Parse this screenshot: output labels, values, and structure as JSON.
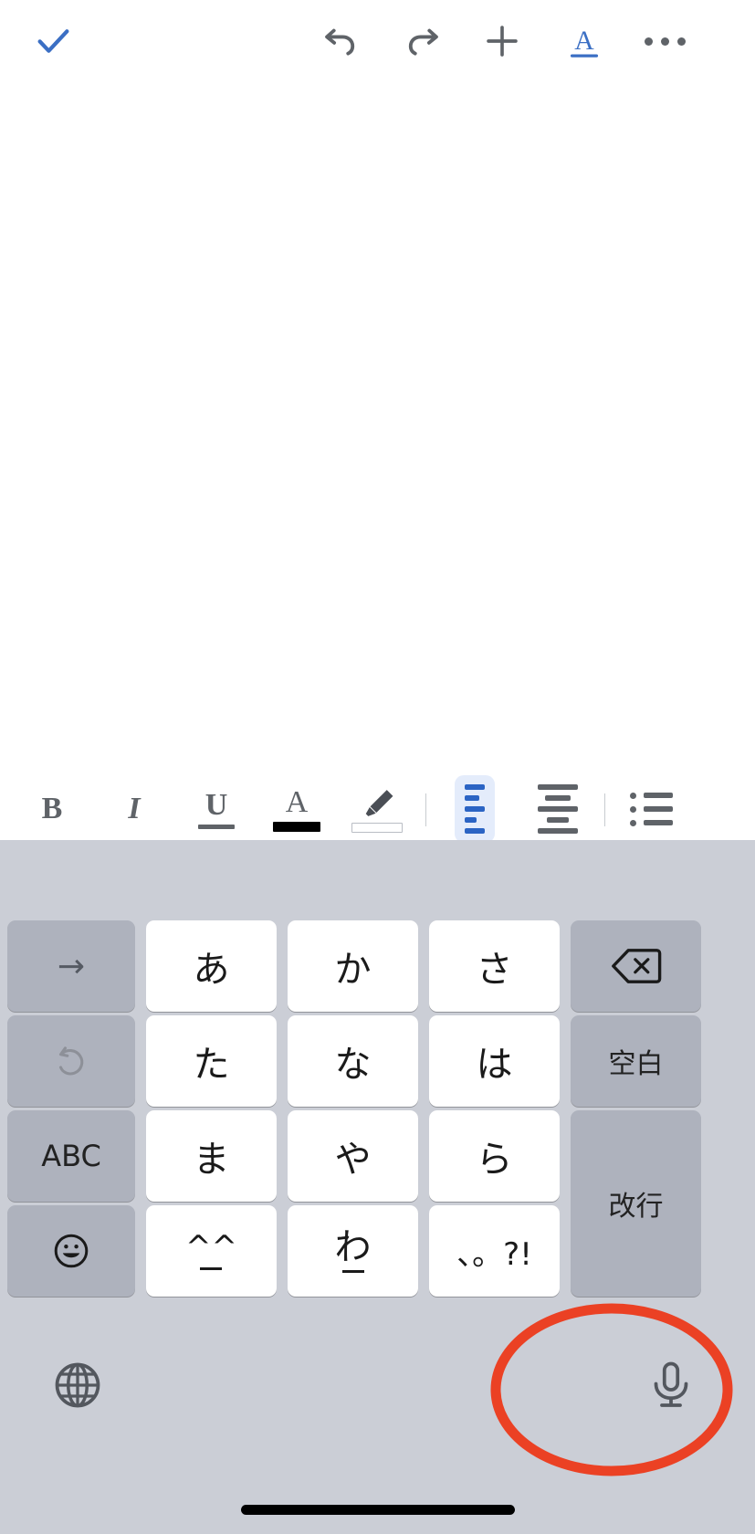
{
  "app": {
    "screen_name": "note-editor-with-japanese-kana-keyboard",
    "background_color": "#ffffff",
    "keyboard_background_color": "#cbced6"
  },
  "top_toolbar": {
    "items": [
      {
        "name": "done-button",
        "icon": "checkmark-icon",
        "color": "#3b6fc4",
        "interactable": true
      },
      {
        "name": "undo-button",
        "icon": "undo-arrow-icon",
        "color": "#5f6368",
        "interactable": true
      },
      {
        "name": "redo-button",
        "icon": "redo-arrow-icon",
        "color": "#5f6368",
        "interactable": true
      },
      {
        "name": "insert-button",
        "icon": "plus-icon",
        "color": "#5f6368",
        "interactable": true
      },
      {
        "name": "text-format-button",
        "icon": "underlined-a-icon",
        "color": "#3b6fc4",
        "label": "A",
        "interactable": true
      },
      {
        "name": "more-options-button",
        "icon": "ellipsis-icon",
        "color": "#5f6368",
        "interactable": true
      }
    ]
  },
  "format_bar": {
    "bold_label": "B",
    "italic_label": "I",
    "underline_label": "U",
    "text_color_label": "A",
    "text_color_swatch": "#000000",
    "highlight_swatch": "#ffffff",
    "items": [
      {
        "name": "bold-button",
        "icon": "bold-icon",
        "active": false
      },
      {
        "name": "italic-button",
        "icon": "italic-icon",
        "active": false
      },
      {
        "name": "underline-button",
        "icon": "underline-icon",
        "active": false
      },
      {
        "name": "text-color-button",
        "icon": "text-color-a-icon",
        "active": false
      },
      {
        "name": "highlight-button",
        "icon": "highlighter-pen-icon",
        "active": false
      },
      {
        "name": "align-left-button",
        "icon": "align-left-icon",
        "active": true
      },
      {
        "name": "align-center-button",
        "icon": "align-center-icon",
        "active": false
      },
      {
        "name": "bulleted-list-button",
        "icon": "bulleted-list-icon",
        "active": false
      }
    ],
    "active_color": "#2b64c4",
    "active_background": "#e4ecfb",
    "inactive_color": "#5f6368"
  },
  "keyboard": {
    "layout": "japanese-kana-12key",
    "rows": [
      [
        {
          "name": "key-next-candidate",
          "label": "→",
          "type": "gray",
          "role": "function"
        },
        {
          "name": "key-a-row",
          "label": "あ",
          "type": "white",
          "role": "kana"
        },
        {
          "name": "key-ka-row",
          "label": "か",
          "type": "white",
          "role": "kana"
        },
        {
          "name": "key-sa-row",
          "label": "さ",
          "type": "white",
          "role": "kana"
        },
        {
          "name": "key-backspace",
          "label": "⌫",
          "type": "gray",
          "role": "function"
        }
      ],
      [
        {
          "name": "key-undo",
          "label": "↺",
          "type": "gray",
          "role": "function",
          "disabled": true
        },
        {
          "name": "key-ta-row",
          "label": "た",
          "type": "white",
          "role": "kana"
        },
        {
          "name": "key-na-row",
          "label": "な",
          "type": "white",
          "role": "kana"
        },
        {
          "name": "key-ha-row",
          "label": "は",
          "type": "white",
          "role": "kana"
        },
        {
          "name": "key-space",
          "label": "空白",
          "type": "gray",
          "role": "function"
        }
      ],
      [
        {
          "name": "key-abc-mode",
          "label": "ABC",
          "type": "gray",
          "role": "function"
        },
        {
          "name": "key-ma-row",
          "label": "ま",
          "type": "white",
          "role": "kana"
        },
        {
          "name": "key-ya-row",
          "label": "や",
          "type": "white",
          "role": "kana"
        },
        {
          "name": "key-ra-row",
          "label": "ら",
          "type": "white",
          "role": "kana"
        },
        {
          "name": "key-return",
          "label": "改行",
          "type": "gray",
          "role": "function",
          "tall": true
        }
      ],
      [
        {
          "name": "key-emoji",
          "label": "☺",
          "type": "gray",
          "role": "function"
        },
        {
          "name": "key-kaomoji",
          "label": "^^",
          "type": "white",
          "role": "kana",
          "underscore": true
        },
        {
          "name": "key-wa-row",
          "label": "わ",
          "type": "white",
          "role": "kana",
          "underscore": true
        },
        {
          "name": "key-punctuation",
          "label": "、。?!",
          "type": "white",
          "role": "kana"
        }
      ]
    ],
    "bottom_row": [
      {
        "name": "globe-keyboard-switch-button",
        "icon": "globe-icon",
        "interactable": true
      },
      {
        "name": "dictation-button",
        "icon": "microphone-icon",
        "interactable": true
      }
    ],
    "key_white_color": "#ffffff",
    "key_gray_color": "#aeb2bd"
  },
  "annotation": {
    "name": "highlight-ellipse",
    "shape": "ellipse",
    "color": "#eb4124",
    "stroke_width": 11,
    "targets": "dictation-button"
  },
  "home_indicator": {
    "name": "home-indicator",
    "color": "#000000"
  }
}
